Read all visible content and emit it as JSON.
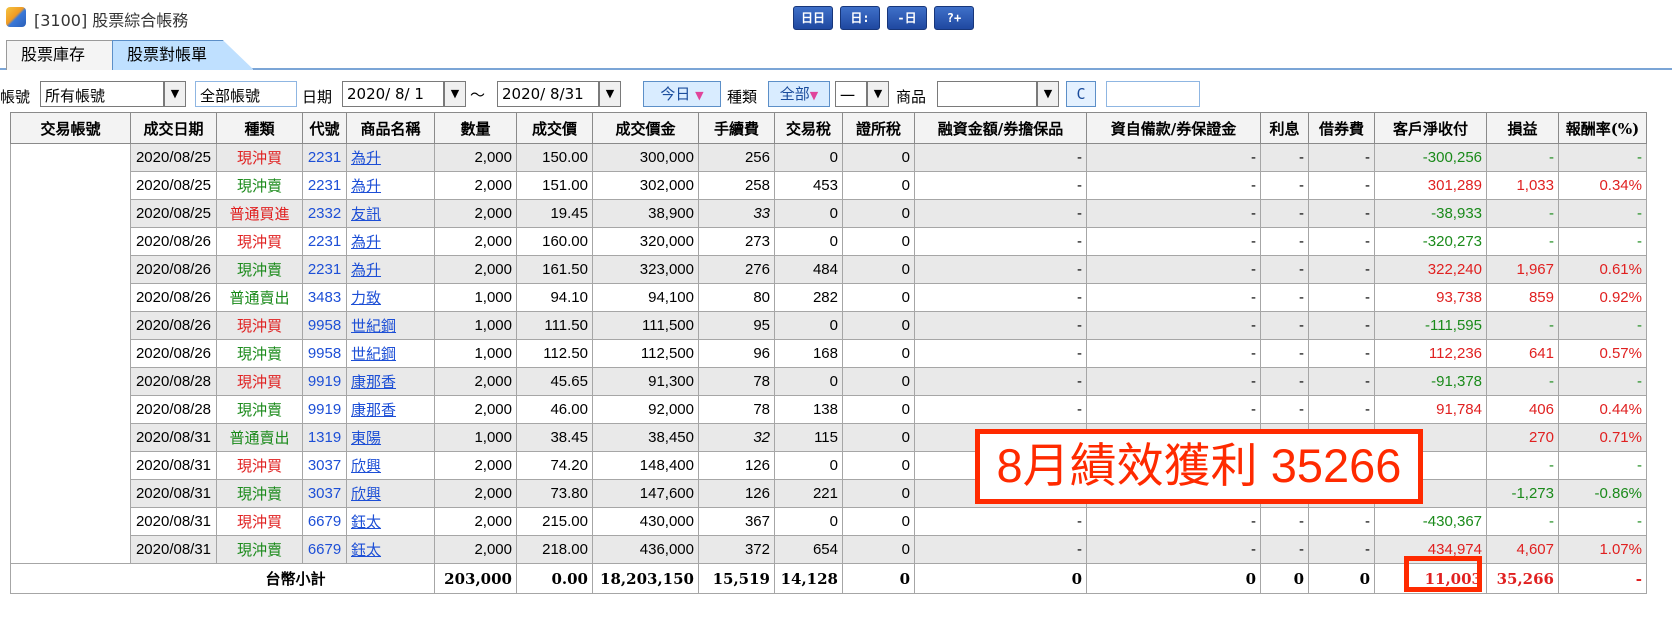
{
  "window": {
    "title": "[3100] 股票綜合帳務"
  },
  "toolbar_icons": [
    "layout-icon",
    "window-icon",
    "export-icon",
    "help-icon"
  ],
  "toolbar_labels": [
    "日日",
    "日:",
    "-日",
    "?+"
  ],
  "tabs": [
    {
      "label": "股票庫存"
    },
    {
      "label": "股票對帳單"
    }
  ],
  "filters": {
    "account_label": "帳號",
    "account_value": "所有帳號",
    "all_accounts": "全部帳號",
    "date_label": "日期",
    "date_from": "2020/ 8/ 1",
    "date_tilde": "～",
    "date_to": "2020/ 8/31",
    "today_button": "今日",
    "type_label": "種類",
    "type_value": "全部",
    "subtype_value": "一",
    "product_label": "商品",
    "product_value": "",
    "c_button": "C"
  },
  "columns": [
    "交易帳號",
    "成交日期",
    "種類",
    "代號",
    "商品名稱",
    "數量",
    "成交價",
    "成交價金",
    "手續費",
    "交易稅",
    "證所稅",
    "融資金額/券擔保品",
    "資自備款/券保證金",
    "利息",
    "借券費",
    "客戶淨收付",
    "損益",
    "報酬率(%)"
  ],
  "rows": [
    {
      "date": "2020/08/25",
      "type": "現沖買",
      "code": "2231",
      "name": "為升",
      "qty": "2,000",
      "price": "150.00",
      "amount": "300,000",
      "fee": "256",
      "tax": "0",
      "cgt": "0",
      "margin": "-",
      "deposit": "-",
      "interest": "-",
      "lend": "-",
      "net": "-300,256",
      "pl": "-",
      "roi": "-"
    },
    {
      "date": "2020/08/25",
      "type": "現沖賣",
      "code": "2231",
      "name": "為升",
      "qty": "2,000",
      "price": "151.00",
      "amount": "302,000",
      "fee": "258",
      "tax": "453",
      "cgt": "0",
      "margin": "-",
      "deposit": "-",
      "interest": "-",
      "lend": "-",
      "net": "301,289",
      "pl": "1,033",
      "roi": "0.34%"
    },
    {
      "date": "2020/08/25",
      "type": "普通買進",
      "code": "2332",
      "name": "友訊",
      "qty": "2,000",
      "price": "19.45",
      "amount": "38,900",
      "fee": "33",
      "tax": "0",
      "cgt": "0",
      "margin": "-",
      "deposit": "-",
      "interest": "-",
      "lend": "-",
      "net": "-38,933",
      "pl": "-",
      "roi": "-"
    },
    {
      "date": "2020/08/26",
      "type": "現沖買",
      "code": "2231",
      "name": "為升",
      "qty": "2,000",
      "price": "160.00",
      "amount": "320,000",
      "fee": "273",
      "tax": "0",
      "cgt": "0",
      "margin": "-",
      "deposit": "-",
      "interest": "-",
      "lend": "-",
      "net": "-320,273",
      "pl": "-",
      "roi": "-"
    },
    {
      "date": "2020/08/26",
      "type": "現沖賣",
      "code": "2231",
      "name": "為升",
      "qty": "2,000",
      "price": "161.50",
      "amount": "323,000",
      "fee": "276",
      "tax": "484",
      "cgt": "0",
      "margin": "-",
      "deposit": "-",
      "interest": "-",
      "lend": "-",
      "net": "322,240",
      "pl": "1,967",
      "roi": "0.61%"
    },
    {
      "date": "2020/08/26",
      "type": "普通賣出",
      "code": "3483",
      "name": "力致",
      "qty": "1,000",
      "price": "94.10",
      "amount": "94,100",
      "fee": "80",
      "tax": "282",
      "cgt": "0",
      "margin": "-",
      "deposit": "-",
      "interest": "-",
      "lend": "-",
      "net": "93,738",
      "pl": "859",
      "roi": "0.92%"
    },
    {
      "date": "2020/08/26",
      "type": "現沖買",
      "code": "9958",
      "name": "世紀鋼",
      "qty": "1,000",
      "price": "111.50",
      "amount": "111,500",
      "fee": "95",
      "tax": "0",
      "cgt": "0",
      "margin": "-",
      "deposit": "-",
      "interest": "-",
      "lend": "-",
      "net": "-111,595",
      "pl": "-",
      "roi": "-"
    },
    {
      "date": "2020/08/26",
      "type": "現沖賣",
      "code": "9958",
      "name": "世紀鋼",
      "qty": "1,000",
      "price": "112.50",
      "amount": "112,500",
      "fee": "96",
      "tax": "168",
      "cgt": "0",
      "margin": "-",
      "deposit": "-",
      "interest": "-",
      "lend": "-",
      "net": "112,236",
      "pl": "641",
      "roi": "0.57%"
    },
    {
      "date": "2020/08/28",
      "type": "現沖買",
      "code": "9919",
      "name": "康那香",
      "qty": "2,000",
      "price": "45.65",
      "amount": "91,300",
      "fee": "78",
      "tax": "0",
      "cgt": "0",
      "margin": "-",
      "deposit": "-",
      "interest": "-",
      "lend": "-",
      "net": "-91,378",
      "pl": "-",
      "roi": "-"
    },
    {
      "date": "2020/08/28",
      "type": "現沖賣",
      "code": "9919",
      "name": "康那香",
      "qty": "2,000",
      "price": "46.00",
      "amount": "92,000",
      "fee": "78",
      "tax": "138",
      "cgt": "0",
      "margin": "-",
      "deposit": "-",
      "interest": "-",
      "lend": "-",
      "net": "91,784",
      "pl": "406",
      "roi": "0.44%"
    },
    {
      "date": "2020/08/31",
      "type": "普通賣出",
      "code": "1319",
      "name": "東陽",
      "qty": "1,000",
      "price": "38.45",
      "amount": "38,450",
      "fee": "32",
      "tax": "115",
      "cgt": "0",
      "margin": "",
      "deposit": "",
      "interest": "",
      "lend": "",
      "net": "",
      "pl": "270",
      "roi": "0.71%"
    },
    {
      "date": "2020/08/31",
      "type": "現沖買",
      "code": "3037",
      "name": "欣興",
      "qty": "2,000",
      "price": "74.20",
      "amount": "148,400",
      "fee": "126",
      "tax": "0",
      "cgt": "0",
      "margin": "",
      "deposit": "",
      "interest": "",
      "lend": "",
      "net": "",
      "pl": "-",
      "roi": "-"
    },
    {
      "date": "2020/08/31",
      "type": "現沖賣",
      "code": "3037",
      "name": "欣興",
      "qty": "2,000",
      "price": "73.80",
      "amount": "147,600",
      "fee": "126",
      "tax": "221",
      "cgt": "0",
      "margin": "",
      "deposit": "",
      "interest": "",
      "lend": "",
      "net": "",
      "pl": "-1,273",
      "roi": "-0.86%"
    },
    {
      "date": "2020/08/31",
      "type": "現沖買",
      "code": "6679",
      "name": "鈺太",
      "qty": "2,000",
      "price": "215.00",
      "amount": "430,000",
      "fee": "367",
      "tax": "0",
      "cgt": "0",
      "margin": "-",
      "deposit": "-",
      "interest": "-",
      "lend": "-",
      "net": "-430,367",
      "pl": "-",
      "roi": "-"
    },
    {
      "date": "2020/08/31",
      "type": "現沖賣",
      "code": "6679",
      "name": "鈺太",
      "qty": "2,000",
      "price": "218.00",
      "amount": "436,000",
      "fee": "372",
      "tax": "654",
      "cgt": "0",
      "margin": "-",
      "deposit": "-",
      "interest": "-",
      "lend": "-",
      "net": "434,974",
      "pl": "4,607",
      "roi": "1.07%"
    }
  ],
  "total": {
    "label": "台幣小計",
    "qty": "203,000",
    "price": "0.00",
    "amount": "18,203,150",
    "fee": "15,519",
    "tax": "14,128",
    "cgt": "0",
    "margin": "0",
    "deposit": "0",
    "interest": "0",
    "lend": "0",
    "net": "11,003",
    "pl": "35,266",
    "roi": "-"
  },
  "annotation": {
    "text": "8月績效獲利 35266"
  },
  "colors": {
    "buy": "#e02020",
    "sell": "#1a8a1a",
    "link": "#1d4fd6",
    "annotation": "#ff2a00",
    "tab_active": "#bfe0ff"
  }
}
